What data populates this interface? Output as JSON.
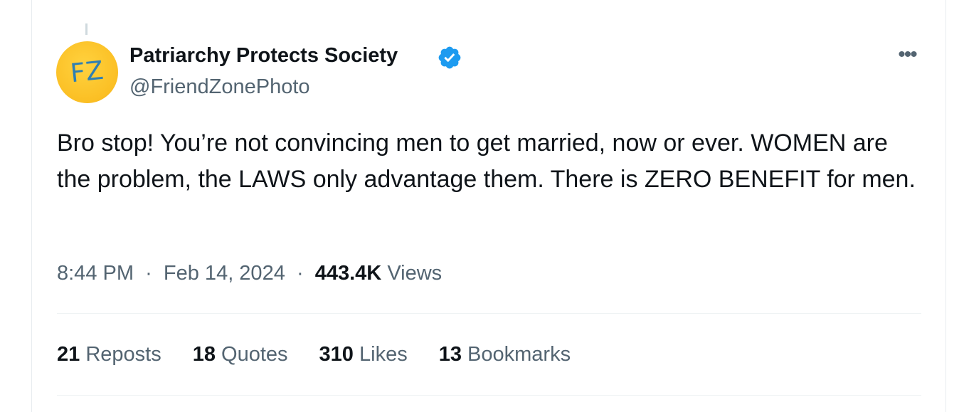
{
  "tweet": {
    "avatar_initials": "FZ",
    "display_name": "Patriarchy Protects Society",
    "handle": "@FriendZonePhoto",
    "text": "Bro stop! You’re not convincing men to get married, now or ever. WOMEN are the problem, the LAWS only advantage them. There is ZERO BENEFIT for men.",
    "time": "8:44 PM",
    "date": "Feb 14, 2024",
    "views_count": "443.4K",
    "views_label": "Views",
    "more_label": "•••"
  },
  "stats": {
    "reposts_count": "21",
    "reposts_label": "Reposts",
    "quotes_count": "18",
    "quotes_label": "Quotes",
    "likes_count": "310",
    "likes_label": "Likes",
    "bookmarks_count": "13",
    "bookmarks_label": "Bookmarks"
  },
  "colors": {
    "verified": "#1d9bf0",
    "secondary_text": "#536471",
    "primary_text": "#0f1419"
  },
  "icons": {
    "verified": "verified-badge-icon",
    "more": "more-icon"
  }
}
